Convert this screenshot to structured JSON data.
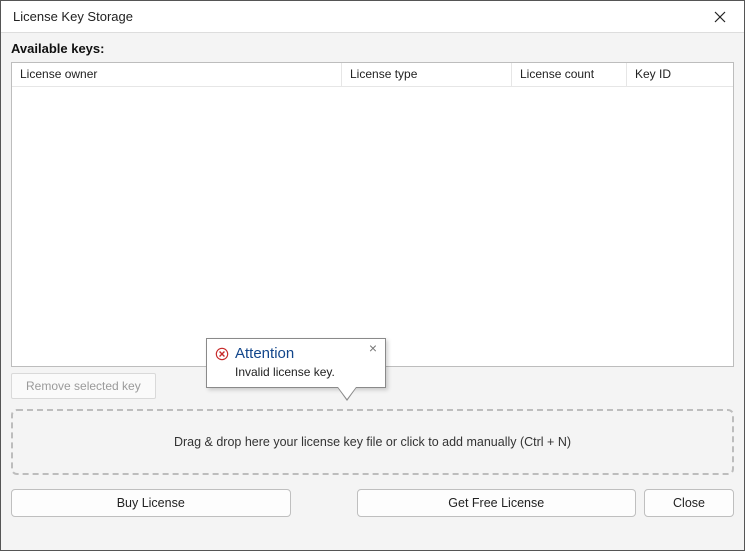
{
  "window": {
    "title": "License Key Storage"
  },
  "labels": {
    "available_keys": "Available keys:"
  },
  "table": {
    "columns": {
      "owner": "License owner",
      "type": "License type",
      "count": "License count",
      "key_id": "Key ID"
    },
    "rows": []
  },
  "buttons": {
    "remove_selected": "Remove selected key",
    "buy": "Buy License",
    "get_free": "Get Free License",
    "close": "Close"
  },
  "dropzone": {
    "text": "Drag & drop here your license key file or click to add manually (Ctrl + N)"
  },
  "popup": {
    "title": "Attention",
    "message": "Invalid license key."
  }
}
